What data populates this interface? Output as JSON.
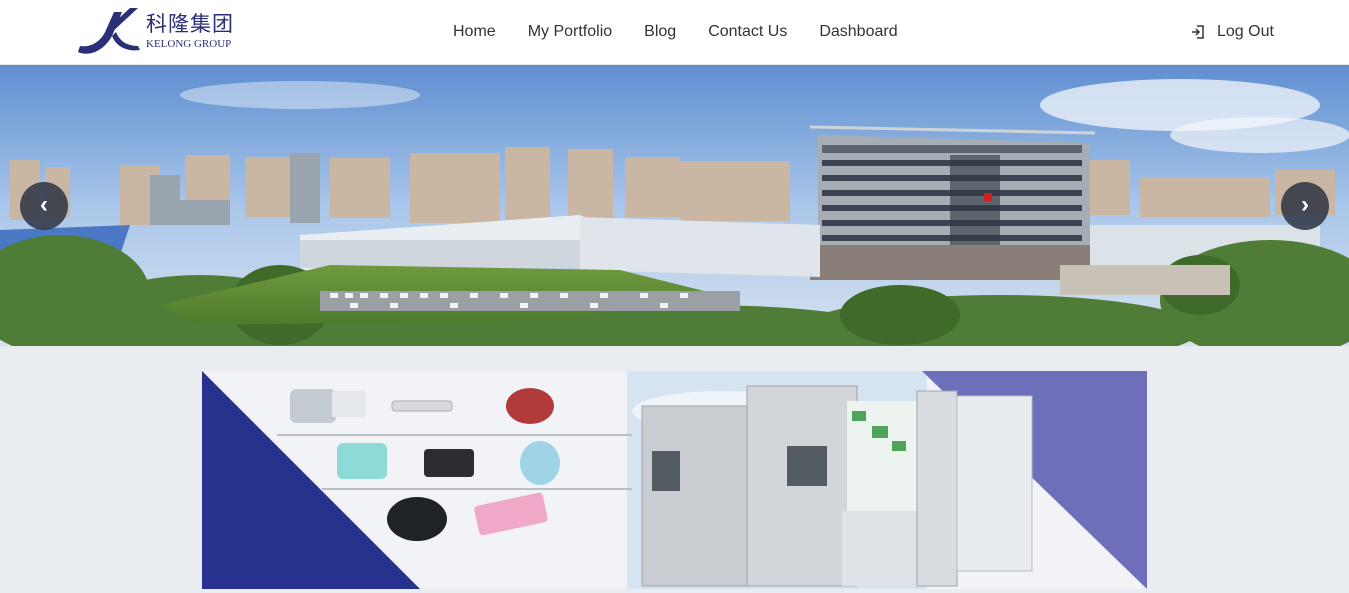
{
  "logo": {
    "cn_text": "科隆集团",
    "en_text": "KELONG GROUP"
  },
  "nav": {
    "home": "Home",
    "portfolio": "My Portfolio",
    "blog": "Blog",
    "contact": "Contact Us",
    "dashboard": "Dashboard"
  },
  "logout": {
    "label": "Log Out",
    "icon": "logout-icon"
  },
  "carousel": {
    "prev_glyph": "‹",
    "next_glyph": "›"
  },
  "colors": {
    "brand": "#2b2f78",
    "banner_dark": "#27318e",
    "banner_light": "#6d6fbb"
  }
}
